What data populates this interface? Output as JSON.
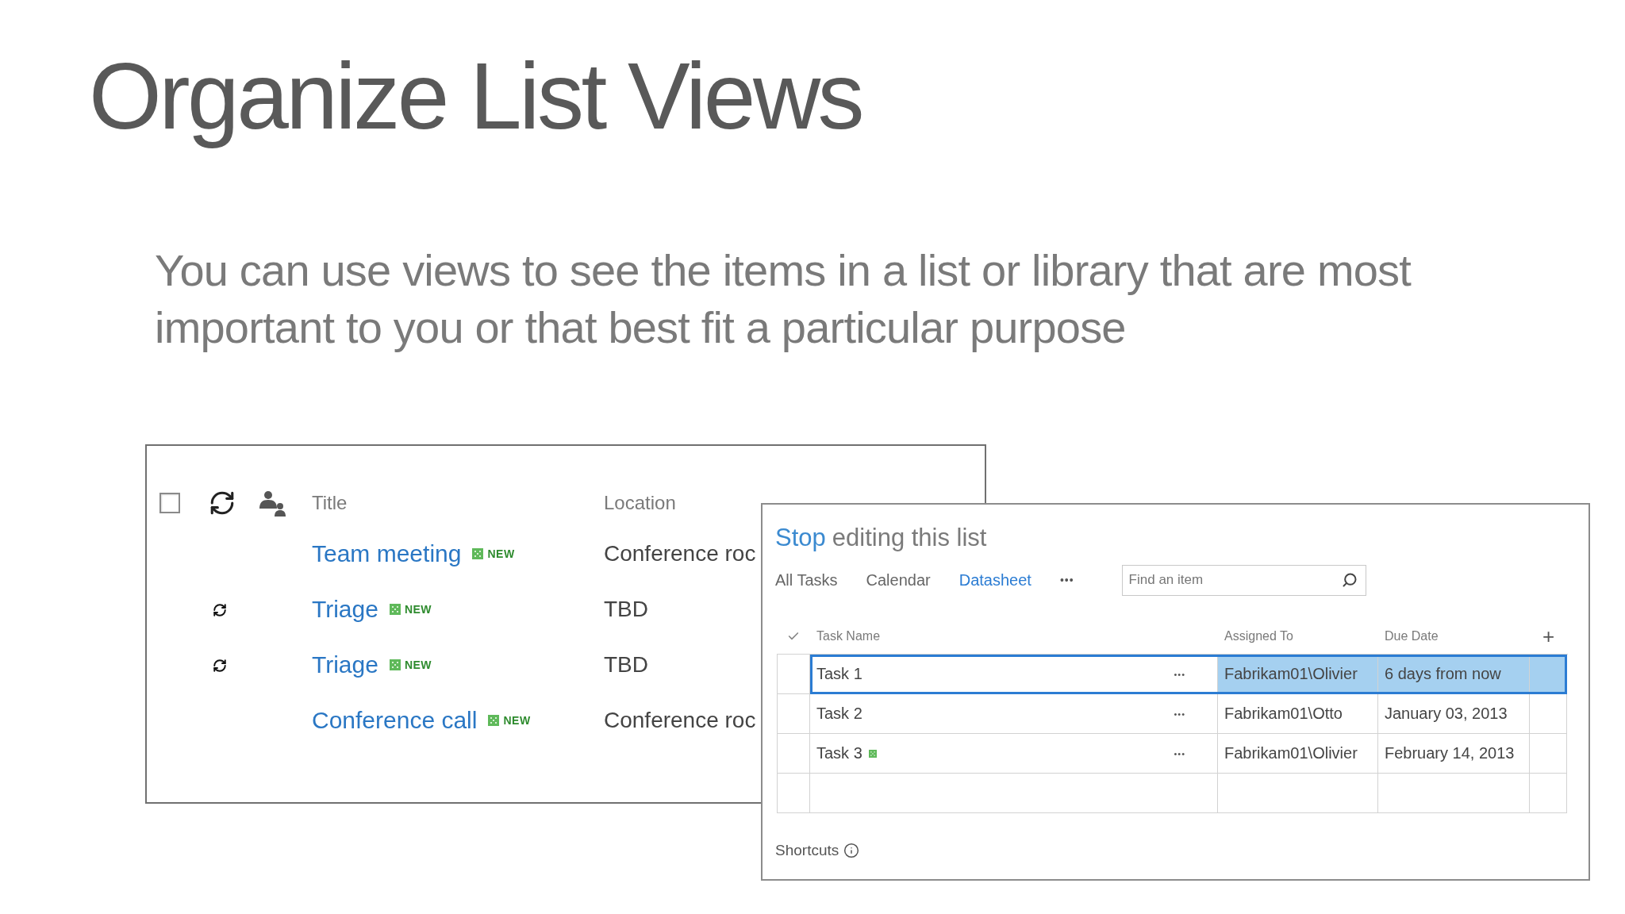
{
  "slide": {
    "title": "Organize List Views",
    "body": "You can use views to see the items in a list or library that are most important to you or that best fit a particular purpose"
  },
  "list_view": {
    "select_all": {
      "checked": false
    },
    "columns": [
      "Title",
      "Location"
    ],
    "rows": [
      {
        "title": "Team meeting",
        "badge": "NEW",
        "location": "Conference roc",
        "recurring": false
      },
      {
        "title": "Triage",
        "badge": "NEW",
        "location": "TBD",
        "recurring": true
      },
      {
        "title": "Triage",
        "badge": "NEW",
        "location": "TBD",
        "recurring": true
      },
      {
        "title": "Conference call",
        "badge": "NEW",
        "location": "Conference roc",
        "recurring": false
      }
    ]
  },
  "datasheet_view": {
    "edit_link": "Stop",
    "edit_text": "editing this list",
    "views": [
      {
        "label": "All Tasks",
        "selected": false
      },
      {
        "label": "Calendar",
        "selected": false
      },
      {
        "label": "Datasheet",
        "selected": true
      }
    ],
    "more_views": "•••",
    "search": {
      "placeholder": "Find an item"
    },
    "columns": [
      "Task Name",
      "Assigned To",
      "Due Date"
    ],
    "add_column": "+",
    "rows": [
      {
        "task": "Task 1",
        "is_new": false,
        "menu": "•••",
        "assigned_to": "Fabrikam01\\Olivier",
        "due_date": "6 days from now",
        "selected": true
      },
      {
        "task": "Task 2",
        "is_new": false,
        "menu": "•••",
        "assigned_to": "Fabrikam01\\Otto",
        "due_date": "January 03, 2013",
        "selected": false
      },
      {
        "task": "Task 3",
        "is_new": true,
        "menu": "•••",
        "assigned_to": "Fabrikam01\\Olivier",
        "due_date": "February 14, 2013",
        "selected": false
      }
    ],
    "shortcuts": "Shortcuts"
  }
}
